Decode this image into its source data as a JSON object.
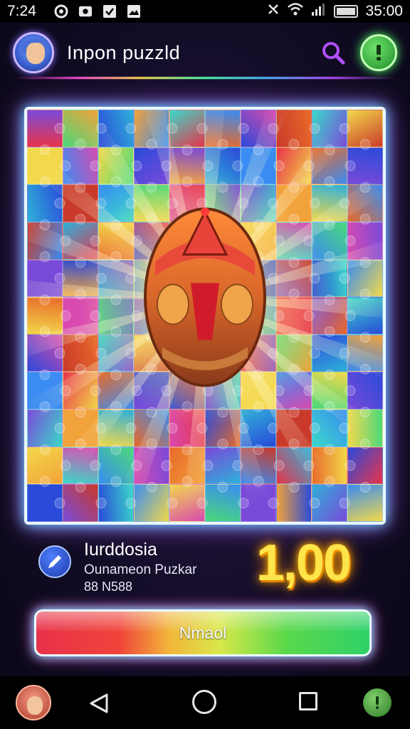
{
  "status_bar": {
    "time": "7:24",
    "clock": "35:00",
    "icons": [
      "camera-icon",
      "photo-icon",
      "checkbox-icon",
      "image-icon",
      "mute-icon",
      "wifi-icon",
      "signal-icon",
      "battery-icon"
    ]
  },
  "header": {
    "title": "Inpon puzzld",
    "icons": [
      "avatar",
      "search-icon",
      "alert-icon"
    ]
  },
  "board": {
    "columns": 10,
    "rows": 11,
    "center_image": "egg-icon"
  },
  "info": {
    "title": "Iurddosia",
    "subtitle": "Ounameon Puzkar",
    "code": "88 N588",
    "score": "1,00"
  },
  "action": {
    "label": "Nmaol"
  },
  "nav": {
    "icons": [
      "avatar",
      "back-icon",
      "home-icon",
      "recent-apps-icon",
      "alert-icon"
    ]
  },
  "colors": {
    "accent_glow": "#5ad8ff",
    "score": "#ffe44a",
    "alert_green": "#2fb83a",
    "search_purple": "#b24fff"
  }
}
